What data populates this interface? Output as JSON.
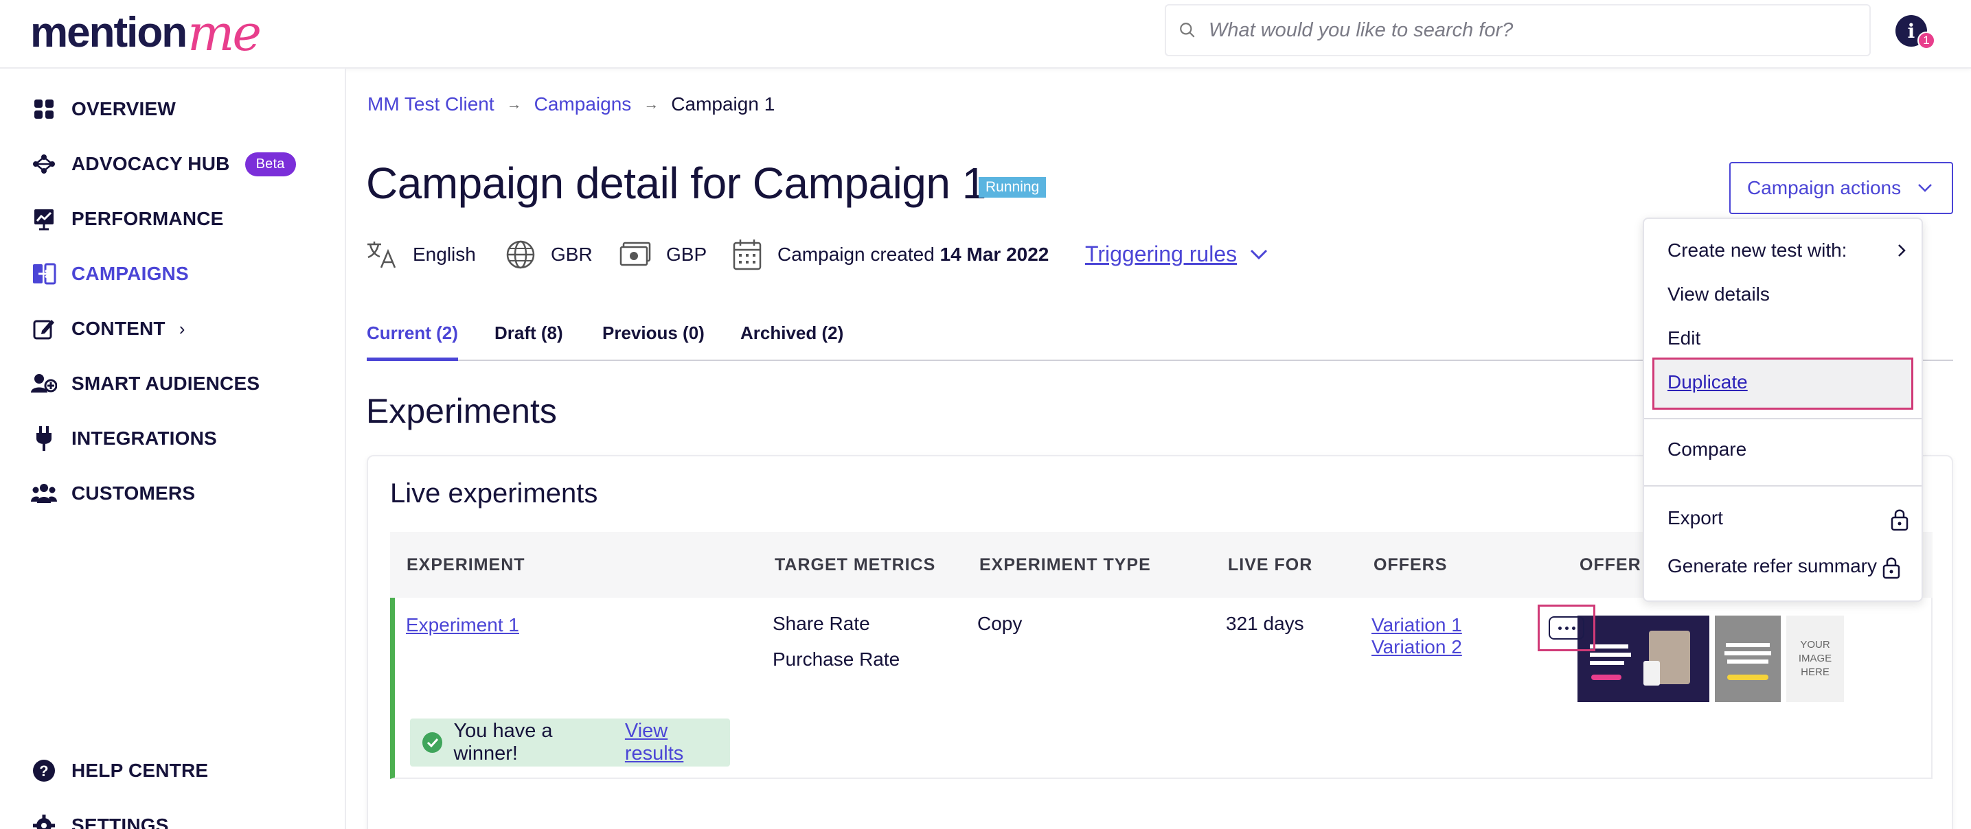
{
  "header": {
    "logo_part1": "mention",
    "logo_part2": "me",
    "search_placeholder": "What would you like to search for?",
    "notification_count": "1"
  },
  "sidebar": {
    "items": [
      {
        "label": "OVERVIEW",
        "icon": "grid-icon"
      },
      {
        "label": "ADVOCACY HUB",
        "icon": "network-icon",
        "badge": "Beta"
      },
      {
        "label": "PERFORMANCE",
        "icon": "chart-icon"
      },
      {
        "label": "CAMPAIGNS",
        "icon": "campaigns-icon",
        "active": true
      },
      {
        "label": "CONTENT",
        "icon": "edit-icon",
        "chevron": "›"
      },
      {
        "label": "SMART AUDIENCES",
        "icon": "audience-icon"
      },
      {
        "label": "INTEGRATIONS",
        "icon": "plug-icon"
      },
      {
        "label": "CUSTOMERS",
        "icon": "customers-icon"
      }
    ],
    "bottom_items": [
      {
        "label": "HELP CENTRE",
        "icon": "help-icon"
      },
      {
        "label": "SETTINGS",
        "icon": "gear-icon"
      }
    ]
  },
  "breadcrumb": [
    "MM Test Client",
    "Campaigns",
    "Campaign 1"
  ],
  "page": {
    "title": "Campaign detail for Campaign 1",
    "status": "Running",
    "actions_label": "Campaign actions",
    "language": "English",
    "country": "GBR",
    "currency": "GBP",
    "created_prefix": "Campaign created",
    "created_date": "14 Mar 2022",
    "triggering_rules": "Triggering rules"
  },
  "tabs": [
    "Current (2)",
    "Draft (8)",
    "Previous (0)",
    "Archived (2)"
  ],
  "experiments": {
    "heading": "Experiments",
    "card_title": "Live experiments",
    "columns": [
      "EXPERIMENT",
      "TARGET METRICS",
      "EXPERIMENT TYPE",
      "LIVE FOR",
      "OFFERS",
      "OFFER I"
    ],
    "row": {
      "name": "Experiment 1",
      "metric1": "Share Rate",
      "metric2": "Purchase Rate",
      "type": "Copy",
      "live_for": "321 days",
      "offer1": "Variation 1",
      "offer2": "Variation 2",
      "placeholder_image": "YOUR IMAGE HERE",
      "winner_text": "You have a winner!",
      "winner_link": "View results"
    }
  },
  "menu": {
    "items": [
      "Create new test with:",
      "View details",
      "Edit",
      "Duplicate",
      "Compare",
      "Export",
      "Generate refer summary"
    ]
  },
  "colors": {
    "accent": "#4b45d6",
    "brand_pink": "#e83e8c",
    "success": "#4caf50",
    "highlight": "#d03a77"
  }
}
